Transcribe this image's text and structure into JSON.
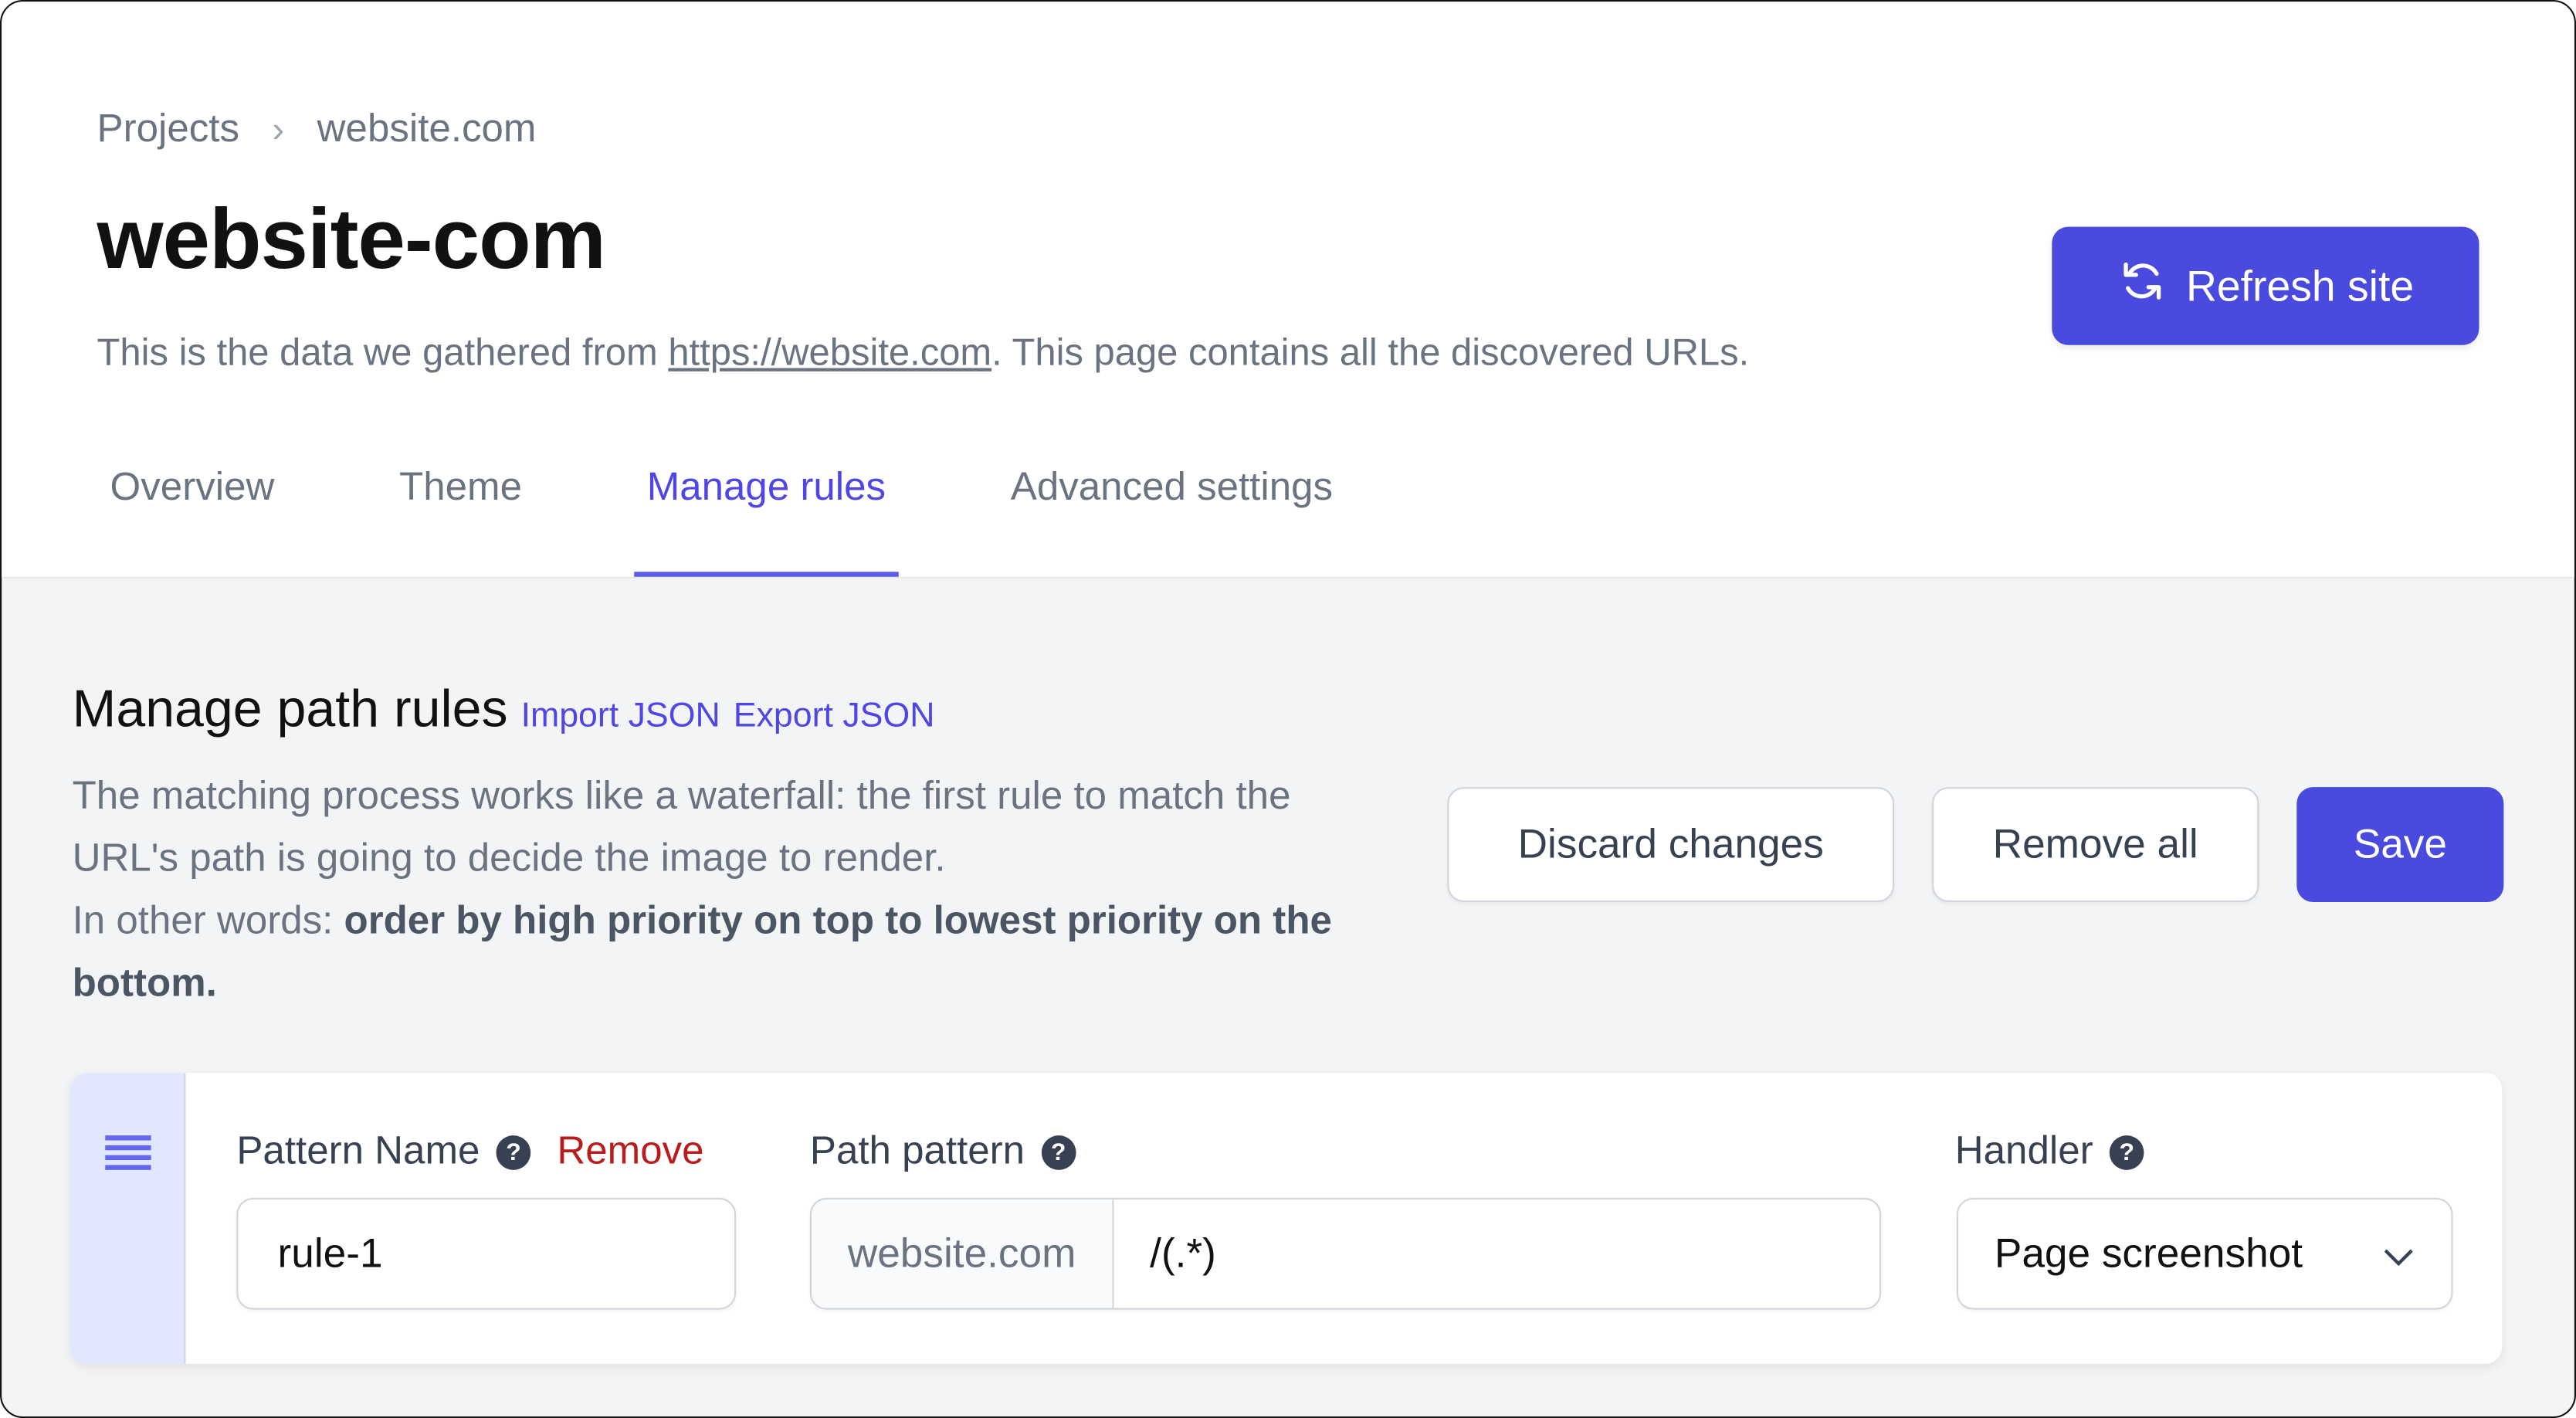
{
  "breadcrumb": {
    "items": [
      "Projects",
      "website.com"
    ],
    "separator": "›"
  },
  "header": {
    "title": "website-com",
    "subtitle_prefix": "This is the data we gathered from ",
    "subtitle_link": "https://website.com",
    "subtitle_suffix": ". This page contains all the discovered URLs.",
    "refresh_label": "Refresh site",
    "refresh_icon": "refresh-icon"
  },
  "tabs": [
    {
      "label": "Overview",
      "active": false
    },
    {
      "label": "Theme",
      "active": false
    },
    {
      "label": "Manage rules",
      "active": true
    },
    {
      "label": "Advanced settings",
      "active": false
    }
  ],
  "section": {
    "title": "Manage path rules",
    "import_label": "Import JSON",
    "export_label": "Export JSON",
    "desc_line1": "The matching process works like a waterfall: the first rule to match the URL's path is going to decide the image to render.",
    "desc_prefix": "In other words: ",
    "desc_bold": "order by high priority on top to lowest priority on the bottom."
  },
  "actions": {
    "discard_label": "Discard changes",
    "remove_all_label": "Remove all",
    "save_label": "Save"
  },
  "rule": {
    "drag_icon": "drag-handle-icon",
    "pattern_name_label": "Pattern Name",
    "remove_label": "Remove",
    "pattern_name_value": "rule-1",
    "path_pattern_label": "Path pattern",
    "path_prefix": "website.com",
    "path_value": "/(.*)",
    "handler_label": "Handler",
    "handler_value": "Page screenshot",
    "help_glyph": "?"
  },
  "colors": {
    "accent": "#4a4ade",
    "danger": "#b91c1c",
    "drag_bg": "#e0e7ff"
  }
}
